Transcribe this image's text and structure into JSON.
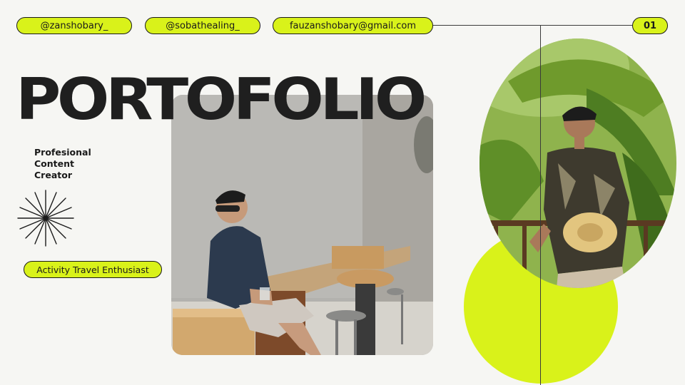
{
  "header": {
    "handle_1": "@zanshobary_",
    "handle_2": "@sobathealing_",
    "email": "fauzanshobary@gmail.com",
    "page_number": "01"
  },
  "hero": {
    "title": "PORTOFOLIO",
    "subtitle_line_1": "Profesional",
    "subtitle_line_2": "Content",
    "subtitle_line_3": "Creator",
    "tag": "Activity Travel Enthusiast"
  },
  "colors": {
    "accent": "#d9f21a",
    "background": "#f6f6f3",
    "text": "#1a1a1a"
  },
  "icons": {
    "decoration": "starburst-icon"
  }
}
